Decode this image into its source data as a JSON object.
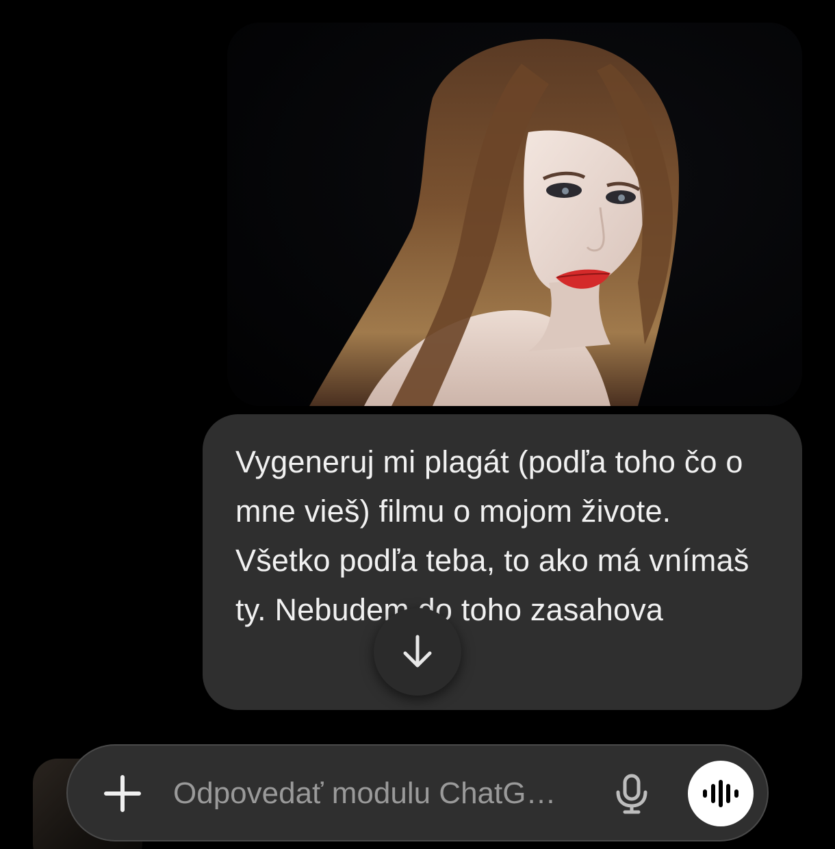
{
  "conversation": {
    "attached_image": {
      "description_icon": "portrait-photo"
    },
    "user_message": {
      "text": "Vygeneruj mi plagát (podľa toho čo o mne vieš) filmu o mojom živote. Všetko podľa teba, to ako má vnímaš ty. Nebudem do toho zasahova"
    }
  },
  "scroll_button": {
    "icon": "arrow-down-icon"
  },
  "composer": {
    "placeholder": "Odpovedať modulu ChatG…",
    "attach_icon": "plus-icon",
    "mic_icon": "microphone-icon",
    "voice_icon": "voice-waveform-icon"
  },
  "colors": {
    "background": "#000000",
    "bubble": "#2f2f2f",
    "text": "#f1f1f1",
    "placeholder": "#9a9a9a",
    "voice_button": "#ffffff"
  }
}
